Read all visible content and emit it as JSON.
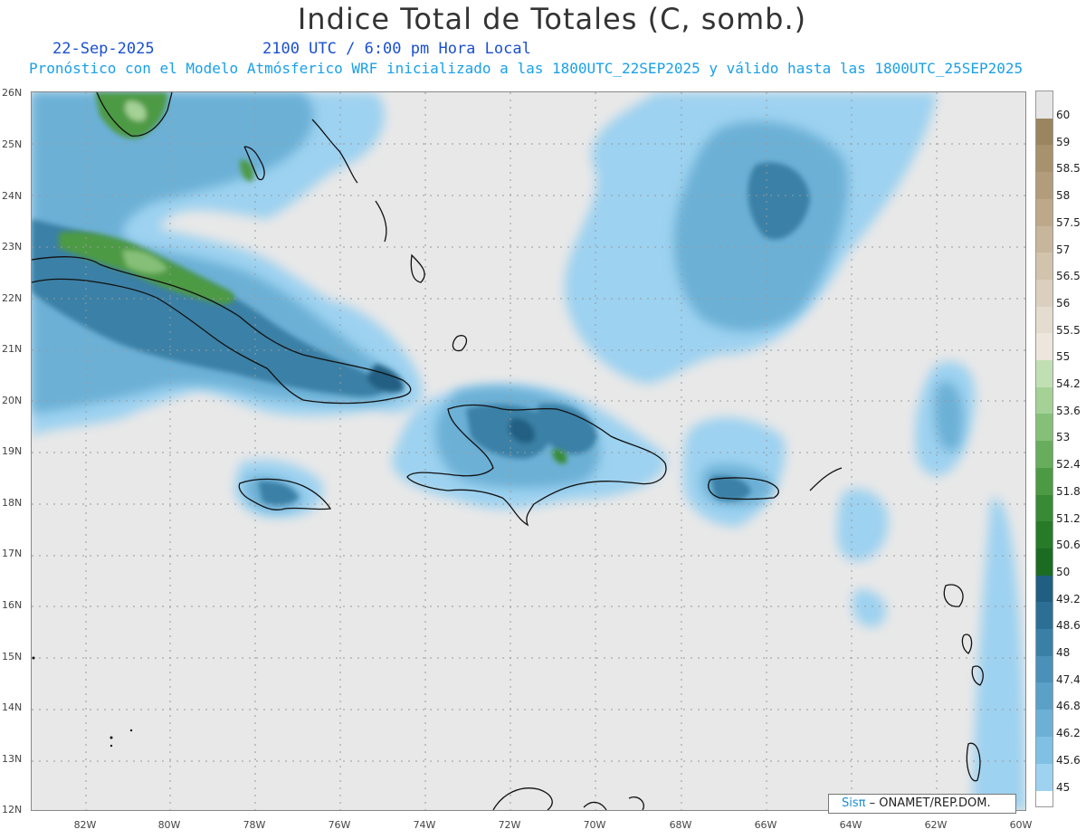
{
  "header": {
    "title": "Indice Total de Totales (C, somb.)",
    "date": "22-Sep-2025",
    "time": "2100 UTC / 6:00 pm Hora Local",
    "subtitle": "Pronóstico con el Modelo Atmósferico WRF inicializado a las 1800UTC_22SEP2025 y válido hasta las  1800UTC_25SEP2025"
  },
  "axes": {
    "lat_labels": [
      "26N",
      "25N",
      "24N",
      "23N",
      "22N",
      "21N",
      "20N",
      "19N",
      "18N",
      "17N",
      "16N",
      "15N",
      "14N",
      "13N",
      "12N"
    ],
    "lon_labels": [
      "82W",
      "80W",
      "78W",
      "76W",
      "74W",
      "72W",
      "70W",
      "68W",
      "66W",
      "64W",
      "62W",
      "60W"
    ]
  },
  "colorbar": {
    "labels": [
      "60",
      "59",
      "58.5",
      "58",
      "57.5",
      "57",
      "56.5",
      "56",
      "55.5",
      "55",
      "54.2",
      "53.6",
      "53",
      "52.4",
      "51.8",
      "51.2",
      "50.6",
      "50",
      "49.2",
      "48.6",
      "48",
      "47.4",
      "46.8",
      "46.2",
      "45.6",
      "45"
    ],
    "colors": [
      "#e6e6e6",
      "#9a8560",
      "#a8916d",
      "#b29c7b",
      "#bda98a",
      "#c7b69b",
      "#d1c3ac",
      "#dbd0bf",
      "#e4dccf",
      "#ece6dc",
      "#c0e0b4",
      "#a4d196",
      "#86c078",
      "#68ad5c",
      "#4d9a44",
      "#388a35",
      "#267a28",
      "#1c6b22",
      "#215f82",
      "#2c6f95",
      "#3a80a6",
      "#4a90b8",
      "#5ba0c6",
      "#6cb0d6",
      "#80c0e4",
      "#9dd2f0"
    ]
  },
  "credit": {
    "logo": "Sisπ",
    "text": "– ONAMET/REP.DOM."
  }
}
